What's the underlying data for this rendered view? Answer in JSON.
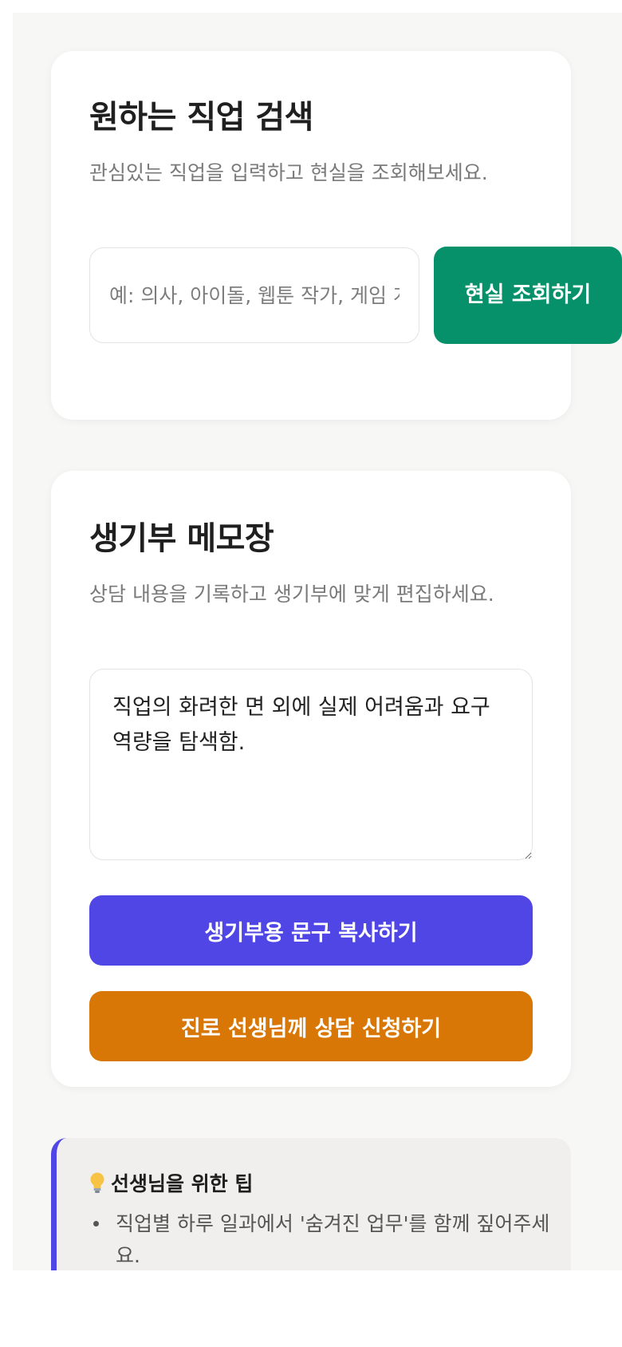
{
  "search_card": {
    "title": "원하는 직업 검색",
    "description": "관심있는 직업을 입력하고 현실을 조회해보세요.",
    "input_placeholder": "예: 의사, 아이돌, 웹툰 작가, 게임 개발자",
    "input_value": "",
    "button_label": "현실 조회하기"
  },
  "memo_card": {
    "title": "생기부 메모장",
    "description": "상담 내용을 기록하고 생기부에 맞게 편집하세요.",
    "textarea_value": "직업의 화려한 면 외에 실제 어려움과 요구 역량을 탐색함.",
    "copy_button_label": "생기부용 문구 복사하기",
    "consult_button_label": "진로 선생님께 상담 신청하기"
  },
  "tips": {
    "icon": "lightbulb-icon",
    "title": "선생님을 위한 팁",
    "items": [
      "직업별 하루 일과에서 '숨겨진 업무'를 함께 짚어주세요."
    ]
  },
  "colors": {
    "search_button": "#06916a",
    "copy_button": "#4f46e5",
    "consult_button": "#d97706",
    "tip_accent": "#4f46e5"
  }
}
